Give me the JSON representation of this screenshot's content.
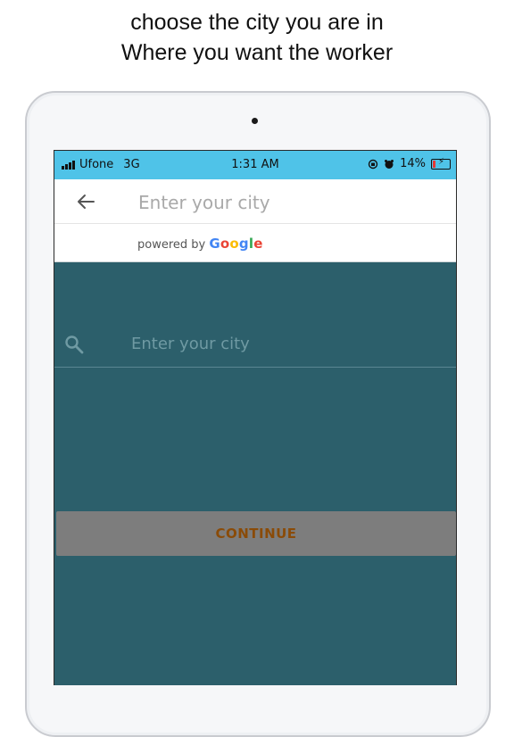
{
  "caption": {
    "line1": "choose the city you are in",
    "line2": "Where you want the worker"
  },
  "status_bar": {
    "carrier": "Ufone",
    "network": "3G",
    "time": "1:31 AM",
    "battery": "14%",
    "icons": [
      "signal-icon",
      "screen-rotation-lock-icon",
      "alarm-icon",
      "battery-charging-icon"
    ]
  },
  "search_overlay": {
    "placeholder": "Enter your city",
    "powered_prefix": "powered by",
    "google_letters": [
      "G",
      "o",
      "o",
      "g",
      "l",
      "e"
    ]
  },
  "city_input": {
    "placeholder": "Enter your city"
  },
  "continue_button": {
    "label": "CONTINUE"
  },
  "colors": {
    "status_bar": "#4fc3e8",
    "background": "#2c5f6b",
    "button": "#7d7d7d",
    "button_text": "#8a4b08"
  }
}
